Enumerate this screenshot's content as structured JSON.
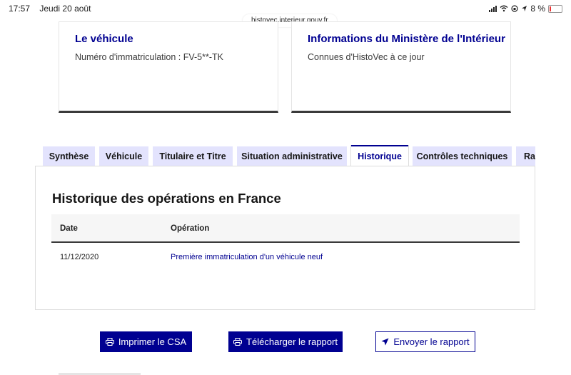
{
  "status_bar": {
    "time": "17:57",
    "date": "Jeudi 20 août",
    "battery": "8 %"
  },
  "browser": {
    "url": "histovec.interieur.gouv.fr"
  },
  "cards": [
    {
      "title": "Le véhicule",
      "description": "Numéro d'immatriculation : FV-5**-TK"
    },
    {
      "title": "Informations du Ministère de l'Intérieur",
      "description": "Connues d'HistoVec à ce jour"
    }
  ],
  "tabs": [
    {
      "label": "Synthèse"
    },
    {
      "label": "Véhicule"
    },
    {
      "label": "Titulaire et Titre"
    },
    {
      "label": "Situation administrative"
    },
    {
      "label": "Historique",
      "active": true
    },
    {
      "label": "Contrôles techniques"
    },
    {
      "label": "Rap"
    }
  ],
  "panel": {
    "title": "Historique des opérations en France",
    "columns": {
      "date": "Date",
      "operation": "Opération"
    },
    "rows": [
      {
        "date": "11/12/2020",
        "operation": "Première immatriculation d'un véhicule neuf"
      }
    ]
  },
  "actions": {
    "print": "Imprimer le CSA",
    "download": "Télécharger le rapport",
    "send": "Envoyer le rapport"
  },
  "colors": {
    "primary": "#000091",
    "tab_bg": "#e3e3fd"
  },
  "icons": [
    "wifi-icon",
    "location-icon",
    "orientation-lock-icon",
    "battery-icon",
    "printer-icon",
    "send-icon"
  ]
}
